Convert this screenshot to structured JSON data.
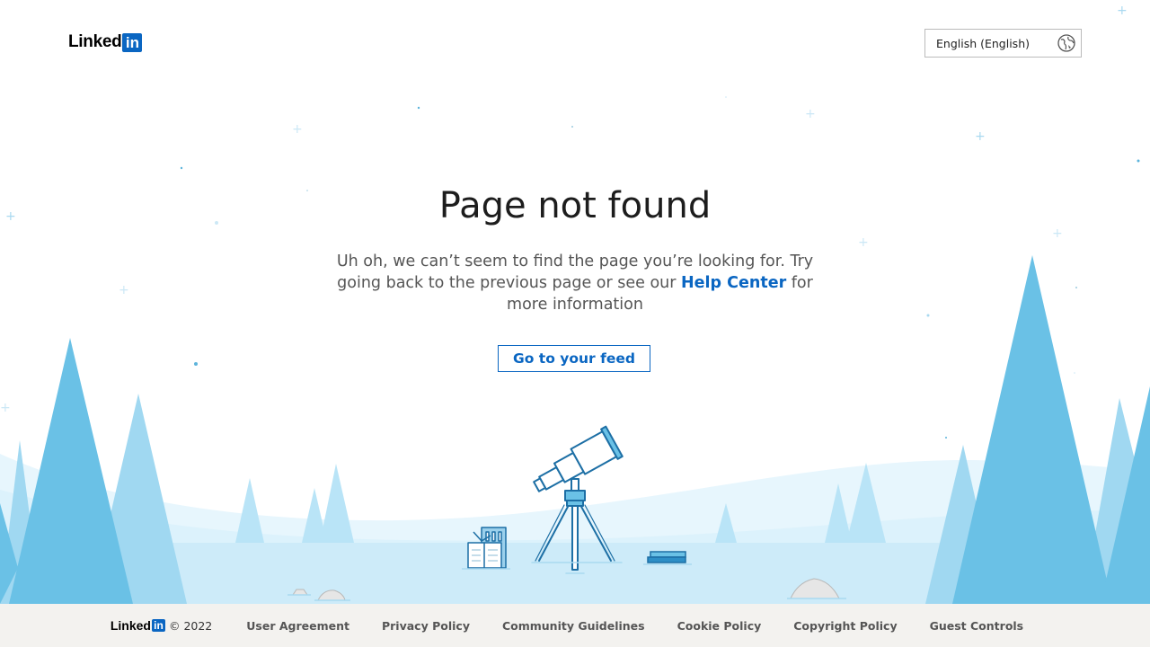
{
  "header": {
    "logo_text": "Linked",
    "logo_box_text": "in",
    "language_selected": "English (English)",
    "language_icon": "globe-icon"
  },
  "main": {
    "title": "Page not found",
    "message_before": "Uh oh, we can’t seem to find the page you’re looking for. Try going back to the previous page or see our ",
    "help_link": "Help Center",
    "message_after": " for more information",
    "feed_button": "Go to your feed",
    "illustration": [
      "telescope-icon",
      "books-icon",
      "trees"
    ]
  },
  "footer": {
    "logo_text": "Linked",
    "logo_box_text": "in",
    "copyright": "© 2022",
    "links": [
      "User Agreement",
      "Privacy Policy",
      "Community Guidelines",
      "Cookie Policy",
      "Copyright Policy",
      "Guest Controls"
    ]
  },
  "colors": {
    "brand": "#0a66c2",
    "tree_dark": "#6ac1e6",
    "tree_light": "#a0d8f1",
    "ground": "#cdebf9",
    "footer_bg": "#f3f2ef"
  }
}
